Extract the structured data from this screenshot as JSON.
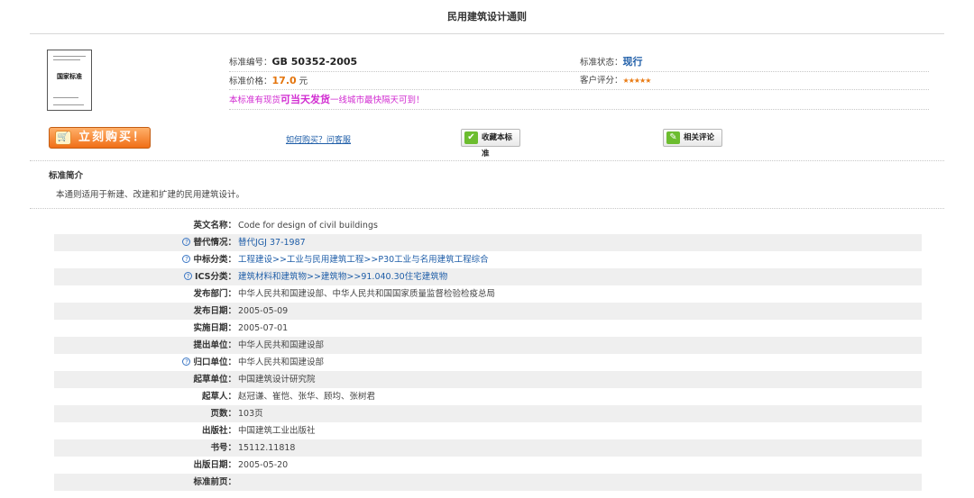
{
  "page": {
    "title": "民用建筑设计通则"
  },
  "cover": {
    "title": "国家标准"
  },
  "info": {
    "std_no_label": "标准编号：",
    "std_no": "GB 50352-2005",
    "status_label": "标准状态：",
    "status": "现行",
    "price_label": "标准价格：",
    "price": "17.0",
    "price_unit": " 元",
    "rating_label": "客户评分：",
    "rating_stars": "★★★★★",
    "shipping_pre": "本标准有现货",
    "shipping_em": "可当天发货",
    "shipping_post": "一线城市最快隔天可到！"
  },
  "actions": {
    "buy": "立刻购买！",
    "how_to_buy": "如何购买？问客服",
    "favorite": "收藏本标准",
    "review": "相关评论"
  },
  "intro": {
    "heading": "标准简介",
    "text": "本通则适用于新建、改建和扩建的民用建筑设计。"
  },
  "details": [
    {
      "label": "英文名称：",
      "value": "Code for design of civil buildings"
    },
    {
      "label": "替代情况：",
      "value": "替代JGJ 37-1987"
    },
    {
      "label": "中标分类：",
      "value": "工程建设>>工业与民用建筑工程>>P30工业与名用建筑工程综合"
    },
    {
      "label": "ICS分类：",
      "value": "建筑材料和建筑物>>建筑物>>91.040.30住宅建筑物"
    },
    {
      "label": "发布部门：",
      "value": "中华人民共和国建设部、中华人民共和国国家质量监督检验检疫总局"
    },
    {
      "label": "发布日期：",
      "value": "2005-05-09"
    },
    {
      "label": "实施日期：",
      "value": "2005-07-01"
    },
    {
      "label": "提出单位：",
      "value": "中华人民共和国建设部"
    },
    {
      "label": "归口单位：",
      "value": "中华人民共和国建设部"
    },
    {
      "label": "起草单位：",
      "value": "中国建筑设计研究院"
    },
    {
      "label": "起草人：",
      "value": "赵冠谦、崔恺、张华、顾均、张树君"
    },
    {
      "label": "页数：",
      "value": "103页"
    },
    {
      "label": "出版社：",
      "value": "中国建筑工业出版社"
    },
    {
      "label": "书号：",
      "value": "15112.11818"
    },
    {
      "label": "出版日期：",
      "value": "2005-05-20"
    },
    {
      "label": "标准前页：",
      "value": ""
    }
  ]
}
